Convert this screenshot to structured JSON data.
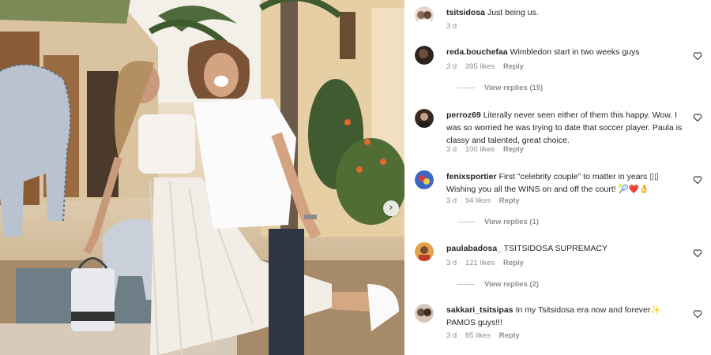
{
  "photo": {
    "description_icon": "carousel-next-icon",
    "next_glyph": "›"
  },
  "comments": [
    {
      "username": "tsitsidosa",
      "text": "Just being us.",
      "time": "3 d",
      "likes": "",
      "reply": "",
      "view_replies": ""
    },
    {
      "username": "reda.bouchefaa",
      "text": "Wimbledon start in two weeks guys",
      "time": "3 d",
      "likes": "395 likes",
      "reply": "Reply",
      "view_replies": "View replies (15)"
    },
    {
      "username": "perroz69",
      "text": "Literally never seen either of them this happy. Wow. I was so worried he was trying to date that soccer player. Paula is classy and talented, great choice.",
      "time": "3 d",
      "likes": "100 likes",
      "reply": "Reply",
      "view_replies": ""
    },
    {
      "username": "fenixsportier",
      "text": "First \"celebrity couple\" to matter in years ▯▯ Wishing you all the WINS on and off the court! 🎾❤️👌",
      "time": "3 d",
      "likes": "94 likes",
      "reply": "Reply",
      "view_replies": "View replies (1)"
    },
    {
      "username": "paulabadosa_",
      "text": "TSITSIDOSA SUPREMACY",
      "time": "3 d",
      "likes": "121 likes",
      "reply": "Reply",
      "view_replies": "View replies (2)"
    },
    {
      "username": "sakkari_tsitsipas",
      "text": "In my Tsitsidosa era now and forever✨ PAMOS guys!!!",
      "time": "3 d",
      "likes": "85 likes",
      "reply": "Reply",
      "view_replies": ""
    }
  ],
  "colors": {
    "meta": "#8e8e8e",
    "text": "#262626",
    "divider": "#c7c7c7"
  }
}
